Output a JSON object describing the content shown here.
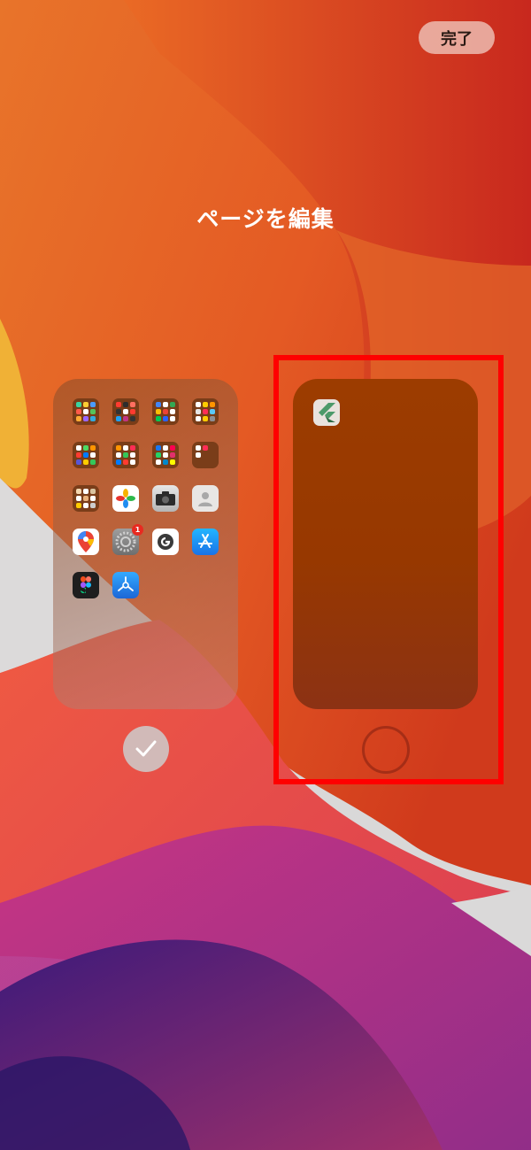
{
  "header": {
    "done_label": "完了"
  },
  "title": "ページを編集",
  "pages": [
    {
      "name": "page-1",
      "selected": true,
      "folders": 8,
      "apps": [
        "photos",
        "camera",
        "contacts",
        "google-maps",
        "settings",
        "google",
        "app-store",
        "figma",
        "testflight"
      ],
      "settings_badge": "1"
    },
    {
      "name": "page-2",
      "selected": false,
      "apps": [
        "flutter"
      ]
    }
  ],
  "colors": {
    "highlight": "#ff0000",
    "accent_orange": "#e86f25"
  }
}
